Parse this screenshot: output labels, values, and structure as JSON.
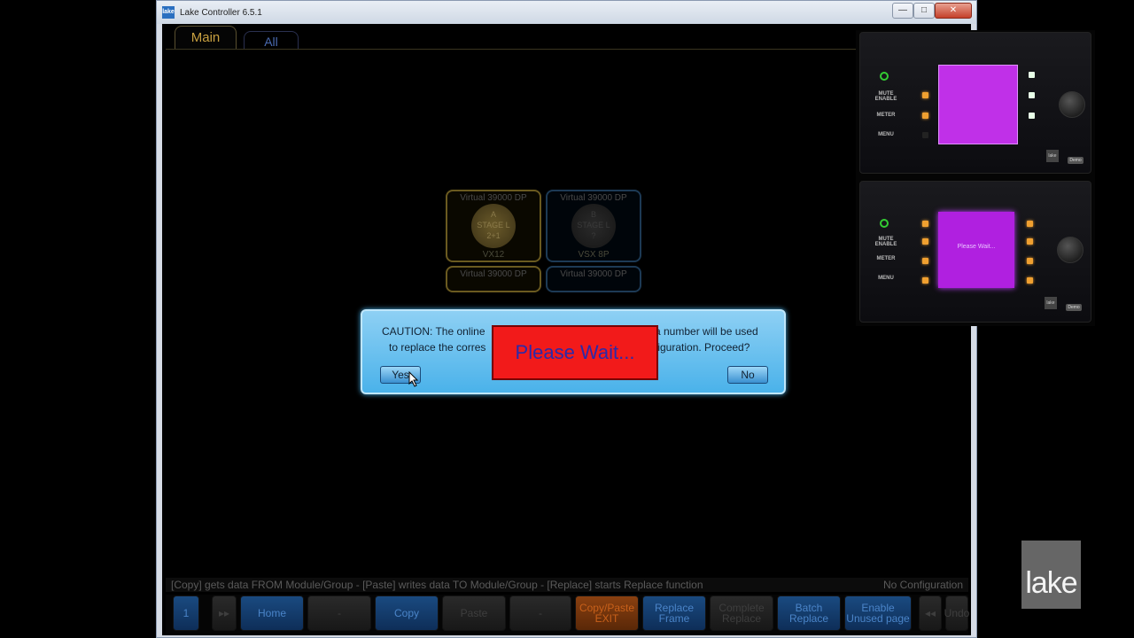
{
  "window": {
    "title": "Lake Controller 6.5.1",
    "icon": "lake",
    "minimize": "—",
    "maximize": "□",
    "close": "✕"
  },
  "tabs": [
    {
      "label": "Main"
    },
    {
      "label": "All"
    }
  ],
  "modules": [
    {
      "header": "Virtual 39000 DP",
      "letter": "A",
      "name": "STAGE L",
      "sub": "2+1",
      "footer": "VX12"
    },
    {
      "header": "Virtual 39000 DP",
      "letter": "B",
      "name": "STAGE L",
      "sub": "?",
      "footer": "VSX 8P"
    },
    {
      "header": "Virtual 39000 DP"
    },
    {
      "header": "Virtual 39000 DP"
    }
  ],
  "dialog": {
    "line1a": "CAUTION: The online",
    "line1b": "a number will be used",
    "line2a": "to replace the corres",
    "line2b": "figuration. Proceed?",
    "yes": "Yes",
    "no": "No",
    "wait": "Please Wait..."
  },
  "status": {
    "left": "[Copy] gets data FROM Module/Group - [Paste] writes data TO Module/Group - [Replace] starts Replace function",
    "right": "No Configuration"
  },
  "fkeys": [
    {
      "label": "1",
      "style": "blue"
    },
    {
      "label": "▸▸",
      "style": "grey"
    },
    {
      "label": "Home",
      "style": "blue"
    },
    {
      "label": "-",
      "style": "grey"
    },
    {
      "label": "Copy",
      "style": "blue"
    },
    {
      "label": "Paste",
      "style": "grey"
    },
    {
      "label": "-",
      "style": "grey"
    },
    {
      "label": "Copy/Paste EXIT",
      "style": "orange"
    },
    {
      "label": "Replace Frame",
      "style": "blue"
    },
    {
      "label": "Complete Replace",
      "style": "grey"
    },
    {
      "label": "Batch Replace",
      "style": "blue"
    },
    {
      "label": "Enable Unused page",
      "style": "blue"
    },
    {
      "label": "◂◂",
      "style": "grey"
    },
    {
      "label": "Undo",
      "style": "grey"
    }
  ],
  "hardware": {
    "labels": [
      "MUTE ENABLE",
      "METER",
      "MENU"
    ],
    "screen2_text": "Please Wait...",
    "badge_lake": "lake",
    "badge_demo": "Demo"
  },
  "logo": "lake"
}
